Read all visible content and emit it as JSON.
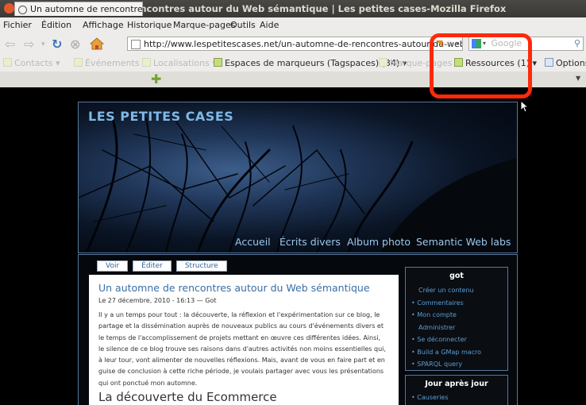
{
  "window": {
    "title": "Un automne de rencontres autour du Web sémantique | Les petites cases-Mozilla Firefox"
  },
  "menu": [
    "Fichier",
    "Édition",
    "Affichage",
    "Historique",
    "Marque-pages",
    "Outils",
    "Aide"
  ],
  "nav": {
    "url": "http://www.lespetitescases.net/un-automne-de-rencontres-autour-du-web-sema",
    "search_placeholder": "Google"
  },
  "bookmarks": [
    {
      "label": "Contacts ▾",
      "active": false
    },
    {
      "label": "Événements ▾",
      "active": false
    },
    {
      "label": "Localisations ▾",
      "active": false
    },
    {
      "label": "Espaces de marqueurs (Tagspaces) (34) ▾",
      "active": true
    },
    {
      "label": "Marque-pages ▾",
      "active": false
    },
    {
      "label": "Ressources (1) ▾",
      "active": true
    },
    {
      "label": "Options",
      "active": true
    }
  ],
  "tab": {
    "label": "Un automne de rencontres aut..."
  },
  "site": {
    "name": "LES PETITES CASES",
    "nav": [
      "Accueil",
      "Écrits divers",
      "Album photo",
      "Semantic Web labs"
    ],
    "tabs": [
      "Voir",
      "Éditer",
      "Structure"
    ]
  },
  "post": {
    "title": "Un automne de rencontres autour du Web sémantique",
    "meta": "Le 27 décembre, 2010 - 16:13 — Got",
    "lines": [
      "Il y a un temps pour tout : la découverte, la réflexion et l'expérimentation sur ce blog, le",
      "partage et la dissémination auprès de nouveaux publics au cours d'événements divers et",
      "le temps de l'accomplissement de projets mettant en œuvre ces différentes idées. Ainsi,",
      "le silence de ce blog trouve ses raisons dans d'autres activités non moins essentielles qui,",
      "à leur tour, vont alimenter de nouvelles réflexions. Mais, avant de vous en faire part et en",
      "guise de conclusion à cette riche période, je voulais partager avec vous les présentations",
      "qui ont ponctué mon automne."
    ],
    "subheading": "La découverte du Ecommerce"
  },
  "sidebar": {
    "user_block": {
      "title": "got",
      "items": [
        "Créer un contenu",
        "Commentaires",
        "Mon compte",
        "Administrer",
        "Se déconnecter",
        "Build a GMap macro",
        "SPARQL query"
      ]
    },
    "day_block": {
      "title": "Jour après jour",
      "items": [
        "Causeries"
      ]
    }
  },
  "colors": {
    "highlight": "#ff2a0a",
    "link": "#3a6ea5",
    "site_title": "#7fb8e6"
  }
}
